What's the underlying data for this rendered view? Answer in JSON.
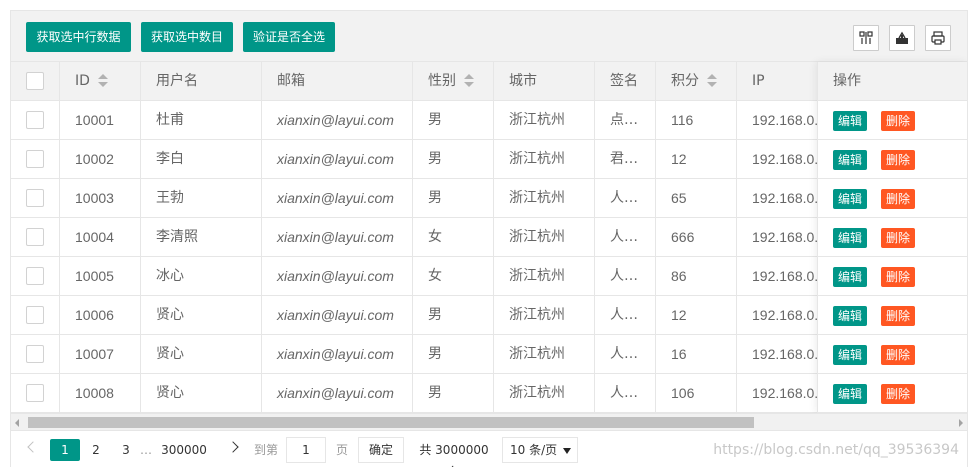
{
  "toolbar": {
    "btn_get_row": "获取选中行数据",
    "btn_get_count": "获取选中数目",
    "btn_verify_all": "验证是否全选",
    "icons": [
      "columns-icon",
      "export-icon",
      "print-icon"
    ]
  },
  "table": {
    "headers": {
      "id": "ID",
      "username": "用户名",
      "email": "邮箱",
      "sex": "性别",
      "city": "城市",
      "sign": "签名",
      "score": "积分",
      "ip": "IP",
      "action": "操作"
    },
    "rows": [
      {
        "id": "10001",
        "username": "杜甫",
        "email": "xianxin@layui.com",
        "sex": "男",
        "city": "浙江杭州",
        "sign": "点…",
        "score": "116",
        "ip": "192.168.0."
      },
      {
        "id": "10002",
        "username": "李白",
        "email": "xianxin@layui.com",
        "sex": "男",
        "city": "浙江杭州",
        "sign": "君…",
        "score": "12",
        "ip": "192.168.0."
      },
      {
        "id": "10003",
        "username": "王勃",
        "email": "xianxin@layui.com",
        "sex": "男",
        "city": "浙江杭州",
        "sign": "人…",
        "score": "65",
        "ip": "192.168.0."
      },
      {
        "id": "10004",
        "username": "李清照",
        "email": "xianxin@layui.com",
        "sex": "女",
        "city": "浙江杭州",
        "sign": "人…",
        "score": "666",
        "ip": "192.168.0."
      },
      {
        "id": "10005",
        "username": "冰心",
        "email": "xianxin@layui.com",
        "sex": "女",
        "city": "浙江杭州",
        "sign": "人…",
        "score": "86",
        "ip": "192.168.0."
      },
      {
        "id": "10006",
        "username": "贤心",
        "email": "xianxin@layui.com",
        "sex": "男",
        "city": "浙江杭州",
        "sign": "人…",
        "score": "12",
        "ip": "192.168.0."
      },
      {
        "id": "10007",
        "username": "贤心",
        "email": "xianxin@layui.com",
        "sex": "男",
        "city": "浙江杭州",
        "sign": "人…",
        "score": "16",
        "ip": "192.168.0."
      },
      {
        "id": "10008",
        "username": "贤心",
        "email": "xianxin@layui.com",
        "sex": "男",
        "city": "浙江杭州",
        "sign": "人…",
        "score": "106",
        "ip": "192.168.0."
      }
    ],
    "edit_label": "编辑",
    "delete_label": "删除"
  },
  "pager": {
    "pages": [
      "1",
      "2",
      "3"
    ],
    "ellipsis": "…",
    "last_page": "300000",
    "goto_label": "到第",
    "goto_value": "1",
    "page_label": "页",
    "confirm_label": "确定",
    "total_label": "共 3000000 条",
    "page_size": "10 条/页"
  },
  "watermark": "https://blog.csdn.net/qq_39536394",
  "colors": {
    "primary": "#009688",
    "danger": "#ff5722",
    "header_bg": "#f2f2f2",
    "border": "#e6e6e6"
  }
}
